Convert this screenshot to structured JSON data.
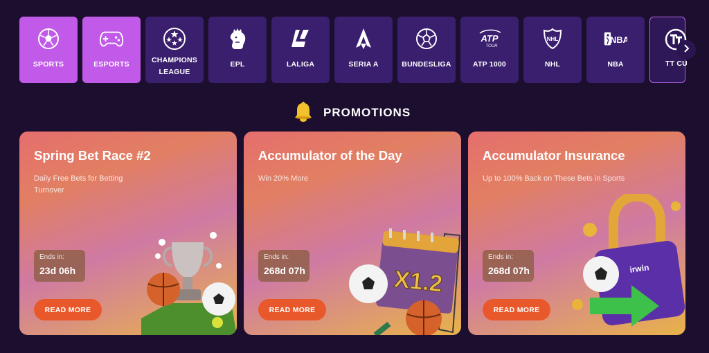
{
  "categories": [
    {
      "label": "SPORTS",
      "icon": "soccer-ball-icon",
      "active": true
    },
    {
      "label": "ESPORTS",
      "icon": "gamepad-icon",
      "active": true
    },
    {
      "label": "CHAMPIONS LEAGUE",
      "line1": "CHAMPIONS",
      "line2": "LEAGUE",
      "icon": "champions-league-icon"
    },
    {
      "label": "EPL",
      "icon": "epl-lion-icon"
    },
    {
      "label": "LALIGA",
      "icon": "laliga-icon"
    },
    {
      "label": "SERIA A",
      "icon": "seria-a-icon"
    },
    {
      "label": "BUNDESLIGA",
      "icon": "bundesliga-ball-icon"
    },
    {
      "label": "ATP 1000",
      "icon": "atp-tour-icon",
      "logo_text": "ATP",
      "logo_sub": "TOUR"
    },
    {
      "label": "NHL",
      "icon": "nhl-shield-icon",
      "logo_text": "NHL"
    },
    {
      "label": "NBA",
      "icon": "nba-icon",
      "logo_text": "NBA"
    },
    {
      "label": "TT CU",
      "icon": "tt-cup-icon"
    }
  ],
  "promotions": {
    "title": "PROMOTIONS",
    "icon": "bell-icon"
  },
  "cards": [
    {
      "title": "Spring Bet Race #2",
      "subtitle": "Daily Free Bets for Betting Turnover",
      "ends_label": "Ends in:",
      "ends_value": "23d 06h",
      "button": "READ MORE",
      "art": "trophy-balls-art"
    },
    {
      "title": "Accumulator of the Day",
      "subtitle": "Win 20% More",
      "ends_label": "Ends in:",
      "ends_value": "268d 07h",
      "button": "READ MORE",
      "art": "calendar-x12-art",
      "art_text": "X1.2"
    },
    {
      "title": "Accumulator Insurance",
      "subtitle": "Up to 100% Back on These Bets in Sports",
      "ends_label": "Ends in:",
      "ends_value": "268d 07h",
      "button": "READ MORE",
      "art": "padlock-art",
      "art_text": "irwin"
    }
  ],
  "colors": {
    "background": "#1b0e2e",
    "tile": "#3a1f6e",
    "tile_active": "#c15ae8",
    "button": "#e9582a",
    "bell": "#f2c12e"
  }
}
